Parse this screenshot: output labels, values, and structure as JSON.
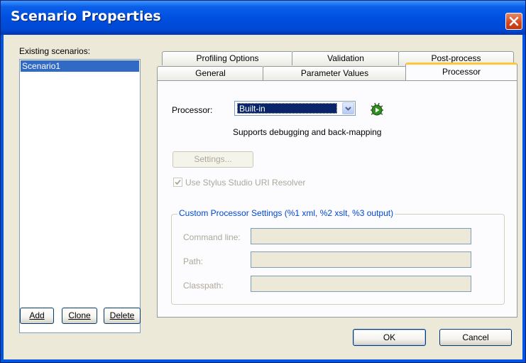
{
  "window": {
    "title": "Scenario Properties"
  },
  "scenarios": {
    "label": "Existing scenarios:",
    "items": [
      "Scenario1"
    ],
    "add_label": "Add",
    "clone_label": "Clone",
    "delete_label": "Delete"
  },
  "tabs": {
    "back_row": [
      "Profiling Options",
      "Validation",
      "Post-process"
    ],
    "front_row": [
      "General",
      "Parameter Values",
      "Processor"
    ],
    "selected": "Processor"
  },
  "processor": {
    "label": "Processor:",
    "value": "Built-in",
    "description": "Supports debugging and back-mapping",
    "settings_label": "Settings...",
    "uri_resolver_label": "Use Stylus Studio URI Resolver",
    "uri_resolver_checked": true,
    "debug_icon": "debug-bug-icon"
  },
  "custom": {
    "title": "Custom Processor Settings (%1 xml, %2 xslt, %3 output)",
    "command_line_label": "Command line:",
    "path_label": "Path:",
    "classpath_label": "Classpath:",
    "command_line_value": "",
    "path_value": "",
    "classpath_value": ""
  },
  "footer": {
    "ok_label": "OK",
    "cancel_label": "Cancel"
  },
  "colors": {
    "titlebar": "#0054e3",
    "selection": "#316ac5",
    "group_title": "#0046d5",
    "tab_highlight": "#ffc83c"
  }
}
